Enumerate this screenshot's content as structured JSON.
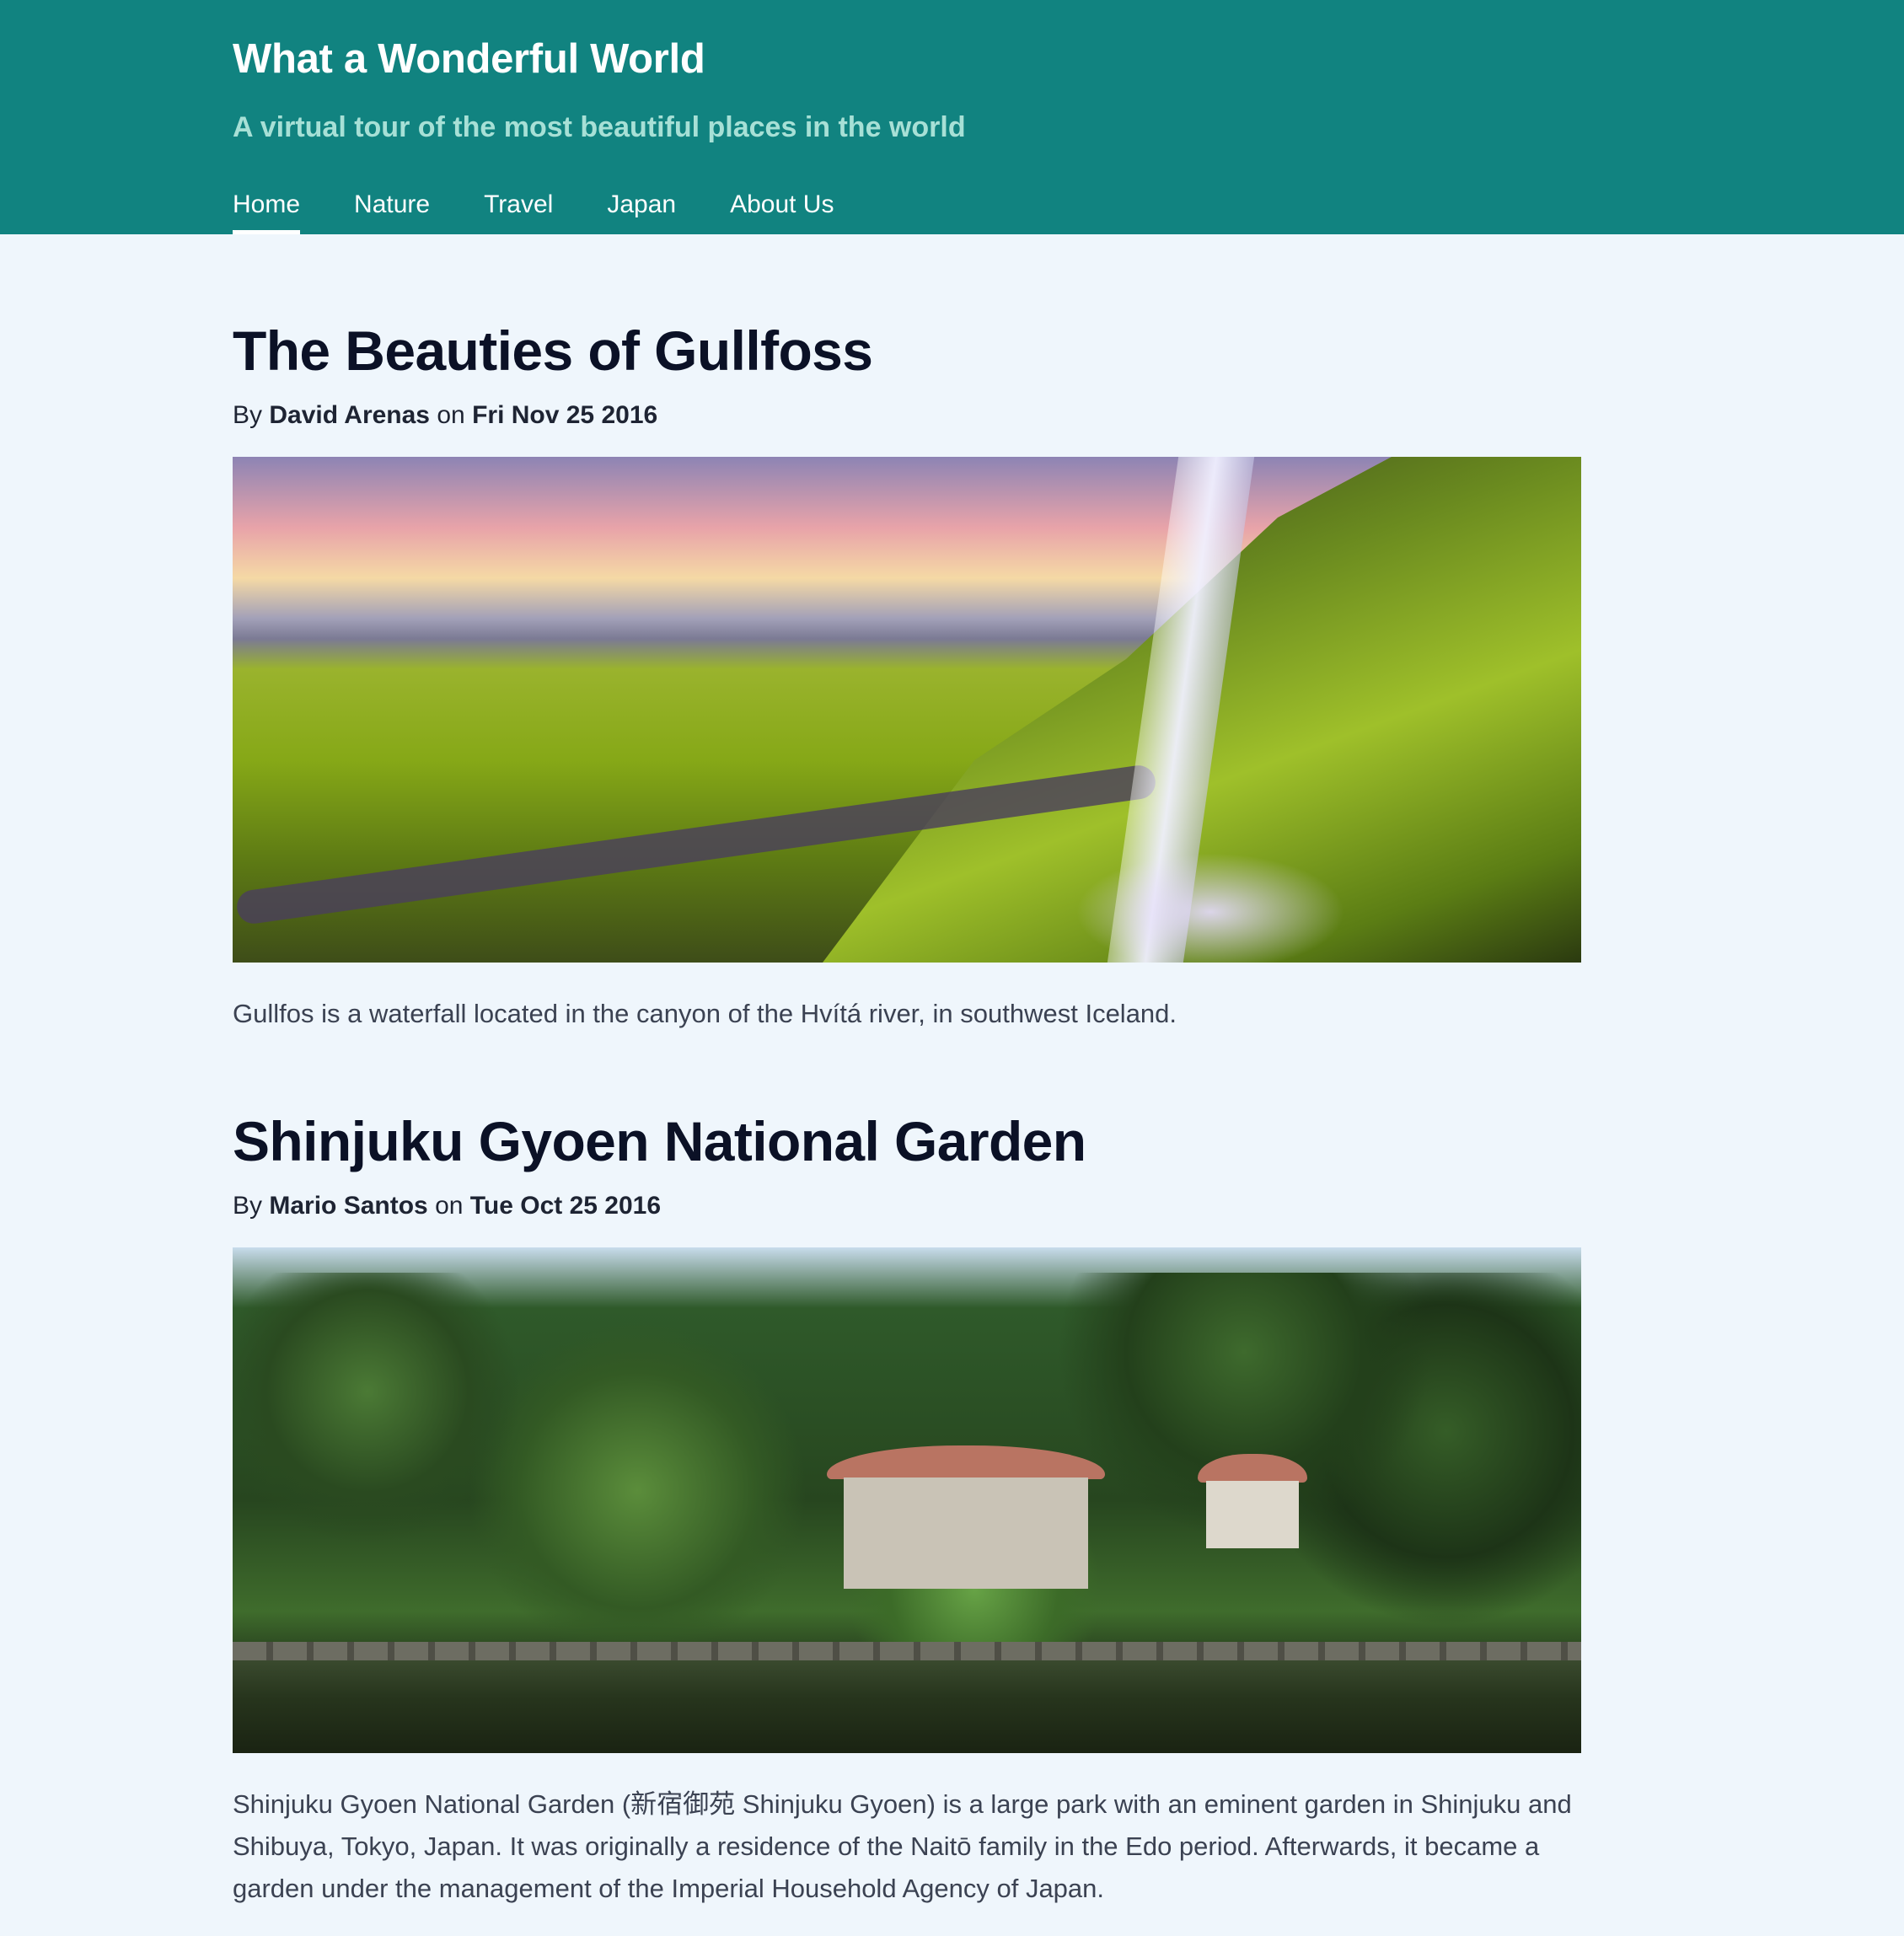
{
  "header": {
    "title": "What a Wonderful World",
    "subtitle": "A virtual tour of the most beautiful places in the world",
    "nav": [
      "Home",
      "Nature",
      "Travel",
      "Japan",
      "About Us"
    ],
    "active_nav": "Home",
    "background_color": "#118380"
  },
  "posts": [
    {
      "title": "The Beauties of Gullfoss",
      "by_label": "By",
      "author": "David Arenas",
      "on_label": "on",
      "date": "Fri Nov 25 2016",
      "image": "waterfall-landscape-image",
      "text": "Gullfos is a waterfall located in the canyon of the Hvítá river, in southwest Iceland."
    },
    {
      "title": "Shinjuku Gyoen National Garden",
      "by_label": "By",
      "author": "Mario Santos",
      "on_label": "on",
      "date": "Tue Oct 25 2016",
      "image": "japanese-garden-image",
      "text": "Shinjuku Gyoen National Garden (新宿御苑 Shinjuku Gyoen) is a large park with an eminent garden in Shinjuku and Shibuya, Tokyo, Japan. It was originally a residence of the Naitō family in the Edo period. Afterwards, it became a garden under the management of the Imperial Household Agency of Japan."
    }
  ]
}
